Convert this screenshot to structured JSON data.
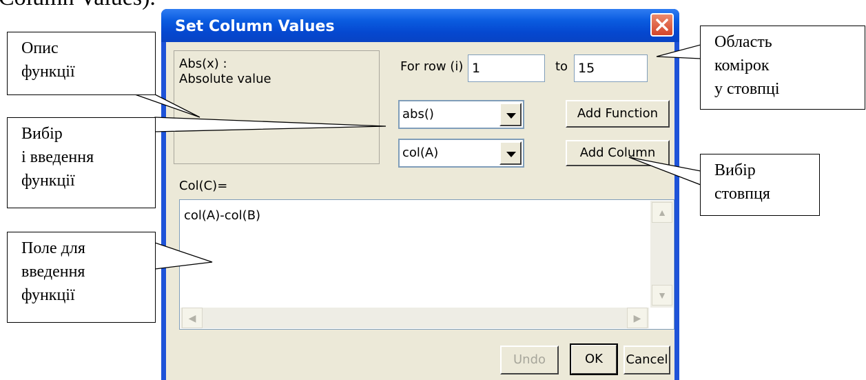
{
  "page_heading": "Column Values).",
  "dialog": {
    "title": "Set Column Values",
    "description": {
      "line1": "Abs(x) :",
      "line2": "Absolute value"
    },
    "row_range": {
      "label_from": "For row (i)",
      "from_value": "1",
      "label_to": "to",
      "to_value": "15"
    },
    "function_combo": {
      "value": "abs()"
    },
    "column_combo": {
      "value": "col(A)"
    },
    "add_function_label": "Add Function",
    "add_column_label": "Add Column",
    "target_label": "Col(C)=",
    "expression": "col(A)-col(B)",
    "buttons": {
      "undo": "Undo",
      "ok": "OK",
      "cancel": "Cancel"
    }
  },
  "callouts": {
    "description": [
      "Опис",
      "функції"
    ],
    "function_select": [
      "Вибір",
      "і введення",
      "функції"
    ],
    "input_field": [
      "Поле для",
      "введення",
      "функції"
    ],
    "cell_range": [
      "Область",
      "комірок",
      "у стовпці"
    ],
    "column_select": [
      "Вибір",
      "стовпця"
    ]
  }
}
